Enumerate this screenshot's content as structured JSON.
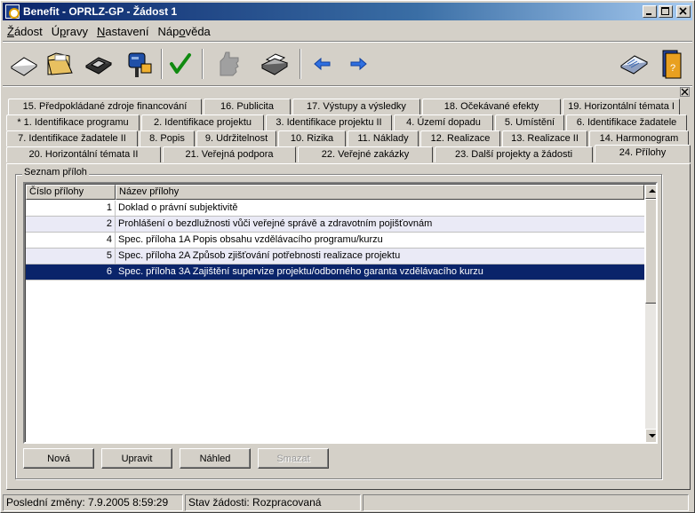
{
  "window": {
    "title": "Benefit - OPRLZ-GP - Žádost 1"
  },
  "menu": [
    {
      "label": "Žádost",
      "underline": "Ž",
      "rest": "ádost"
    },
    {
      "label": "Úpravy",
      "underline": "p",
      "pre": "Ú",
      "rest": "ravy"
    },
    {
      "label": "Nastavení",
      "underline": "N",
      "rest": "astavení"
    },
    {
      "label": "Nápověda",
      "pre": "Náp",
      "underline": "o",
      "rest": "věda"
    }
  ],
  "toolbar": {
    "icons": [
      "new-document-icon",
      "open-folder-icon",
      "save-disk-icon",
      "send-mailbox-icon",
      "check-icon",
      "hand-icon",
      "print-icon",
      "back-arrow-icon",
      "forward-arrow-icon",
      "about-icon",
      "help-book-icon"
    ]
  },
  "tabs": {
    "row1": [
      "15. Předpokládané zdroje financování",
      "16. Publicita",
      "17. Výstupy a výsledky",
      "18. Očekávané efekty",
      "19. Horizontální témata I"
    ],
    "row2": [
      "* 1. Identifikace programu",
      "2. Identifikace projektu",
      "3. Identifikace projektu II",
      "4. Území dopadu",
      "5. Umístění",
      "6. Identifikace žadatele"
    ],
    "row3": [
      "7. Identifikace žadatele II",
      "8. Popis",
      "9. Udržitelnost",
      "10. Rizika",
      "11. Náklady",
      "12. Realizace",
      "13. Realizace II",
      "14. Harmonogram"
    ],
    "row4": [
      "20. Horizontální témata II",
      "21. Veřejná podpora",
      "22. Veřejné zakázky",
      "23. Další projekty a žádosti",
      "24. Přílohy"
    ],
    "active": "24. Přílohy"
  },
  "attachments": {
    "group_title": "Seznam příloh",
    "columns": [
      "Číslo přílohy",
      "Název přílohy"
    ],
    "rows": [
      {
        "number": "1",
        "name": "Doklad o právní subjektivitě"
      },
      {
        "number": "2",
        "name": "Prohlášení o bezdlužnosti vůči veřejné správě a zdravotním pojišťovnám"
      },
      {
        "number": "4",
        "name": "Spec. příloha 1A Popis obsahu vzdělávacího programu/kurzu"
      },
      {
        "number": "5",
        "name": "Spec. příloha 2A Způsob zjišťování potřebnosti realizace projektu"
      },
      {
        "number": "6",
        "name": "Spec. příloha 3A Zajištění supervize projektu/odborného garanta vzdělávacího kurzu"
      }
    ],
    "selected_row": 4
  },
  "buttons": {
    "new": "Nová",
    "edit": "Upravit",
    "preview": "Náhled",
    "delete": "Smazat"
  },
  "status": {
    "last_change": "Poslední změny: 7.9.2005 8:59:29",
    "state": "Stav žádosti: Rozpracovaná"
  },
  "colors": {
    "selection": "#0a246a",
    "title_start": "#0a246a",
    "face": "#d4d0c8"
  }
}
